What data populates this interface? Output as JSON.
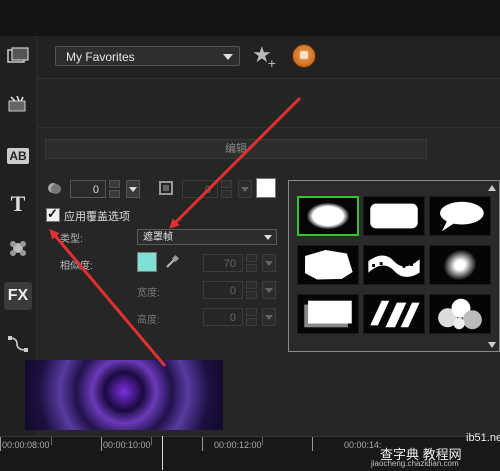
{
  "favorites": {
    "selected": "My Favorites"
  },
  "section_tab": "编辑",
  "mask": {
    "opacity_value": "0",
    "border_value": "0",
    "apply_overlay_label": "应用覆盖选项",
    "type_label": "类型:",
    "type_value": "遮罩帧",
    "opacity2_label": "相似度:",
    "opacity2_value": "70",
    "width_label": "宽度:",
    "width_value": "0",
    "height_label": "高度:",
    "height_value": "0"
  },
  "leftbar": [
    "media-icon",
    "instant-project-icon",
    "title-ab-icon",
    "text-t-icon",
    "transition-icon",
    "fx-icon",
    "path-icon"
  ],
  "leftbar_fx_label": "FX",
  "leftbar_ab_label": "AB",
  "leftbar_t_label": "T",
  "timeline": {
    "t1": "00:00:08:00",
    "t2": "00:00:10:00",
    "t3": "00:00:12:00",
    "t4": "00:00:14:"
  },
  "watermark": {
    "line1": "查字典 教程网",
    "line2": "jiaocheng.chazidian.com",
    "site": "ib51.net"
  },
  "colors": {
    "accent_selection": "#2fc52f",
    "annotation_arrow": "#e03030",
    "swatch_teal": "#7fe0d6",
    "swatch_white": "#ffffff"
  }
}
